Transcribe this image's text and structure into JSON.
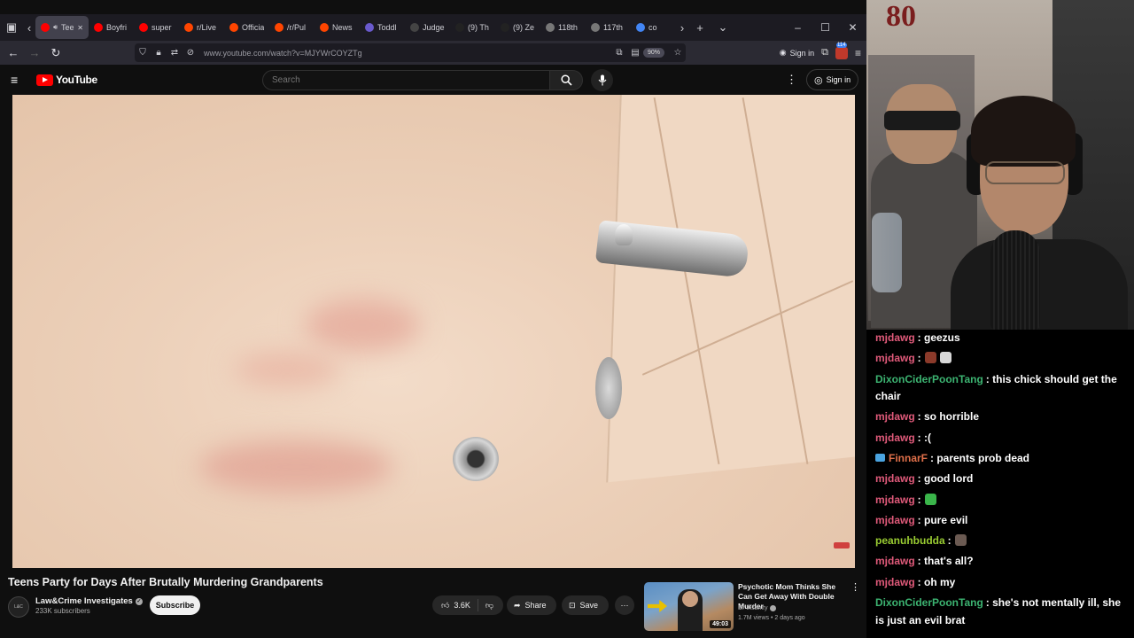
{
  "browser": {
    "tabs": [
      {
        "label": "Tee",
        "color": "#ff0000",
        "active": true
      },
      {
        "label": "Boyfri",
        "color": "#ff0000"
      },
      {
        "label": "super",
        "color": "#ff0000"
      },
      {
        "label": "r/Live",
        "color": "#ff4500"
      },
      {
        "label": "Officia",
        "color": "#ff4500"
      },
      {
        "label": "/r/Pul",
        "color": "#ff4500"
      },
      {
        "label": "News",
        "color": "#ff4500"
      },
      {
        "label": "Toddl",
        "color": "#6a5acd"
      },
      {
        "label": "Judge",
        "color": "#444444"
      },
      {
        "label": "(9) Th",
        "color": "#222222"
      },
      {
        "label": "(9) Ze",
        "color": "#222222"
      },
      {
        "label": "118th",
        "color": "#777777"
      },
      {
        "label": "117th",
        "color": "#777777"
      },
      {
        "label": "co",
        "color": "#4285f4"
      }
    ],
    "url": "www.youtube.com/watch?v=MJYWrCOYZTg",
    "zoom": "90%",
    "sign_in": "Sign in",
    "ext_badge_count": "114"
  },
  "youtube": {
    "logo_text": "YouTube",
    "search_placeholder": "Search",
    "sign_in": "Sign in",
    "video_title": "Teens Party for Days After Brutally Murdering Grandparents",
    "channel_name": "Law&Crime Investigates",
    "subscribers": "233K subscribers",
    "subscribe_label": "Subscribe",
    "likes": "3.6K",
    "share_label": "Share",
    "save_label": "Save",
    "recommended": {
      "title": "Psychotic Mom Thinks She Can Get Away With Double Murder",
      "channel": "Dr Insanity",
      "meta": "1.7M views • 2 days ago",
      "duration": "49:03"
    }
  },
  "chat": {
    "messages": [
      {
        "user": "mjdawg",
        "color": "#e05a7a",
        "text": ": geezus"
      },
      {
        "user": "mjdawg",
        "color": "#e05a7a",
        "text": ":",
        "emotes": [
          "#8b3a2a",
          "#d8d8d8"
        ]
      },
      {
        "user": "DixonCiderPoonTang",
        "color": "#3cb371",
        "text": ": this chick should get the chair"
      },
      {
        "user": "mjdawg",
        "color": "#e05a7a",
        "text": ": so horrible"
      },
      {
        "user": "mjdawg",
        "color": "#e05a7a",
        "text": ": :("
      },
      {
        "user": "FinnarF",
        "color": "#e0704a",
        "text": ": parents prob dead",
        "badge": true
      },
      {
        "user": "mjdawg",
        "color": "#e05a7a",
        "text": ": good lord"
      },
      {
        "user": "mjdawg",
        "color": "#e05a7a",
        "text": ":",
        "emotes": [
          "#3ab54a"
        ]
      },
      {
        "user": "mjdawg",
        "color": "#e05a7a",
        "text": ": pure evil"
      },
      {
        "user": "peanuhbudda",
        "color": "#9acd32",
        "text": ":",
        "emotes": [
          "#6b5a52"
        ]
      },
      {
        "user": "mjdawg",
        "color": "#e05a7a",
        "text": ": that's all?"
      },
      {
        "user": "mjdawg",
        "color": "#e05a7a",
        "text": ": oh my"
      },
      {
        "user": "DixonCiderPoonTang",
        "color": "#3cb371",
        "text": ": she's not mentally ill, she is just an evil brat"
      }
    ]
  },
  "webcam": {
    "sign_text": "80"
  }
}
